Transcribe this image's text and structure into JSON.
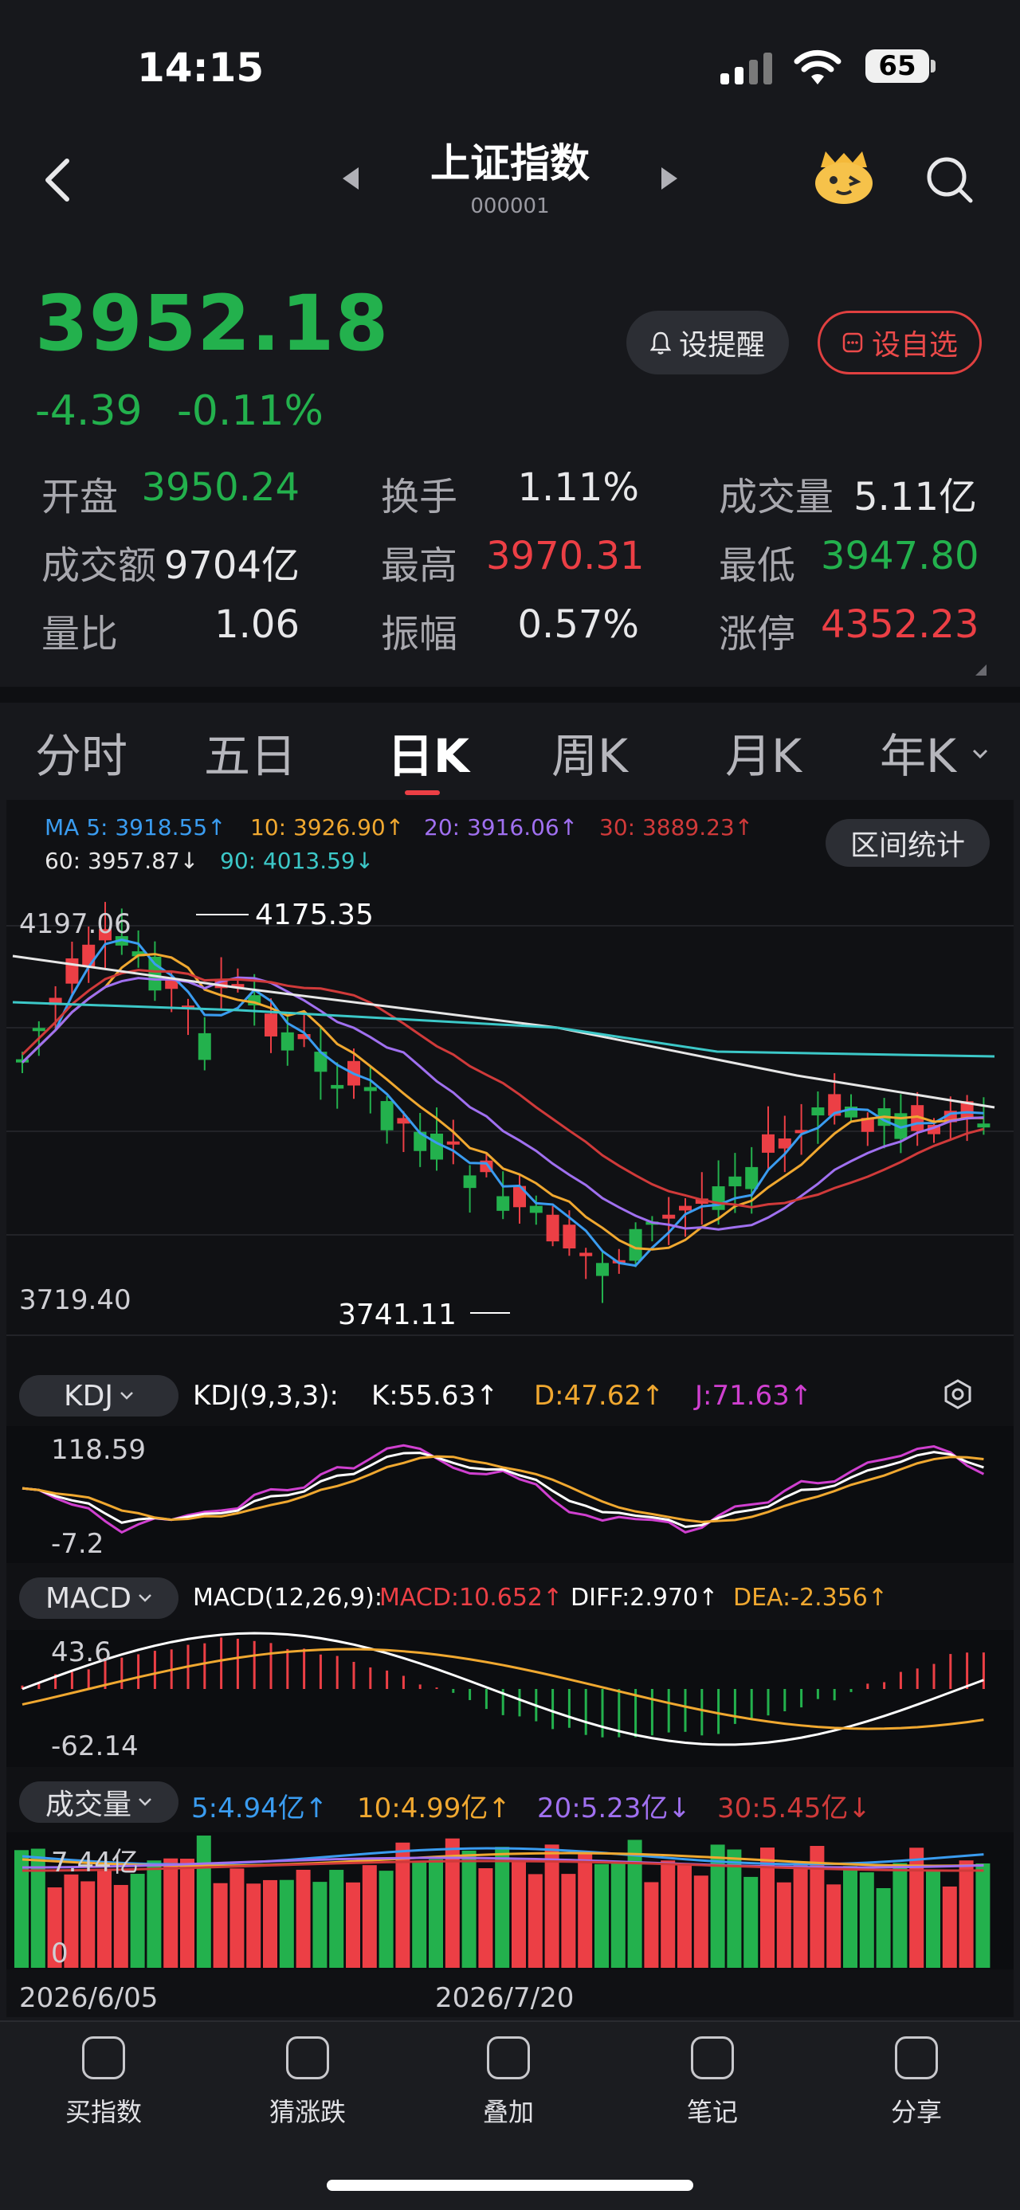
{
  "status": {
    "time": "14:15",
    "battery": "65"
  },
  "header": {
    "title": "上证指数",
    "code": "000001"
  },
  "quote": {
    "price": "3952.18",
    "change": "-4.39",
    "change_pct": "-0.11%"
  },
  "actions": {
    "alert": "设提醒",
    "favorite": "设自选"
  },
  "stats": [
    {
      "label": "开盘",
      "value": "3950.24",
      "color": "green"
    },
    {
      "label": "换手",
      "value": "1.11%",
      "color": "white"
    },
    {
      "label": "成交量",
      "value": "5.11亿",
      "color": "white"
    },
    {
      "label": "成交额",
      "value": "9704亿",
      "color": "white"
    },
    {
      "label": "最高",
      "value": "3970.31",
      "color": "red"
    },
    {
      "label": "最低",
      "value": "3947.80",
      "color": "green"
    },
    {
      "label": "量比",
      "value": "1.06",
      "color": "white"
    },
    {
      "label": "振幅",
      "value": "0.57%",
      "color": "white"
    },
    {
      "label": "涨停",
      "value": "4352.23",
      "color": "red"
    }
  ],
  "tabs": [
    "分时",
    "五日",
    "日K",
    "周K",
    "月K",
    "年K"
  ],
  "ma": {
    "ma5": "MA 5: 3918.55↑",
    "ma10": "10: 3926.90↑",
    "ma20": "20: 3916.06↑",
    "ma30": "30: 3889.23↑",
    "ma60": "60: 3957.87↓",
    "ma90": "90: 4013.59↓",
    "range_btn": "区间统计"
  },
  "kline": {
    "y_top": "4197.06",
    "y_bottom": "3719.40",
    "high_label": "4175.35",
    "low_label": "3741.11"
  },
  "kdj": {
    "label": "KDJ",
    "params": "KDJ(9,3,3):",
    "k": "K:55.63↑",
    "d": "D:47.62↑",
    "j": "J:71.63↑",
    "y_top": "118.59",
    "y_bottom": "-7.2"
  },
  "macd": {
    "label": "MACD",
    "params": "MACD(12,26,9):",
    "macd": "MACD:10.652↑",
    "diff": "DIFF:2.970↑",
    "dea": "DEA:-2.356↑",
    "y_top": "43.6",
    "y_bottom": "-62.14"
  },
  "volume": {
    "label": "成交量",
    "v5": "5:4.94亿↑",
    "v10": "10:4.99亿↑",
    "v20": "20:5.23亿↓",
    "v30": "30:5.45亿↓",
    "y_top": "7.44亿",
    "y_bottom": "0"
  },
  "dates": {
    "start": "2026/6/05",
    "mid": "2026/7/20"
  },
  "bottom_nav": [
    "买指数",
    "猜涨跌",
    "叠加",
    "笔记",
    "分享"
  ],
  "colors": {
    "up": "#ec3f45",
    "down": "#23b14d",
    "ma5": "#3a9cf0",
    "ma10": "#f0a830",
    "ma20": "#a070f0",
    "ma30": "#d03a3a",
    "ma60": "#e6e6e6",
    "ma90": "#3cc8c8",
    "j_line": "#d040d0"
  }
}
